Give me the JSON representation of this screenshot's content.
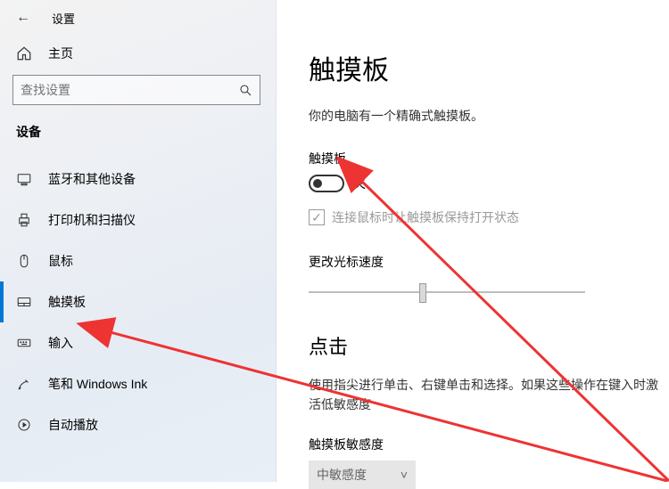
{
  "app": {
    "title": "设置"
  },
  "home": {
    "label": "主页"
  },
  "search": {
    "placeholder": "查找设置"
  },
  "section": {
    "title": "设备"
  },
  "nav": [
    {
      "icon": "bluetooth",
      "label": "蓝牙和其他设备"
    },
    {
      "icon": "printer",
      "label": "打印机和扫描仪"
    },
    {
      "icon": "mouse",
      "label": "鼠标"
    },
    {
      "icon": "touchpad",
      "label": "触摸板",
      "active": true
    },
    {
      "icon": "keyboard",
      "label": "输入"
    },
    {
      "icon": "pen",
      "label": "笔和 Windows Ink"
    },
    {
      "icon": "autoplay",
      "label": "自动播放"
    }
  ],
  "main": {
    "heading": "触摸板",
    "desc": "你的电脑有一个精确式触摸板。",
    "toggle_label": "触摸板",
    "toggle_state": "关",
    "toggle_on": false,
    "keep_on_mouse_label": "连接鼠标时让触摸板保持打开状态",
    "keep_on_mouse_checked": true,
    "cursor_speed_label": "更改光标速度",
    "cursor_speed_value": 5,
    "cursor_speed_min": 1,
    "cursor_speed_max": 10,
    "tap_heading": "点击",
    "tap_desc": "使用指尖进行单击、右键单击和选择。如果这些操作在键入时激活低敏感度",
    "sensitivity_label": "触摸板敏感度",
    "sensitivity_value": "中敏感度"
  }
}
